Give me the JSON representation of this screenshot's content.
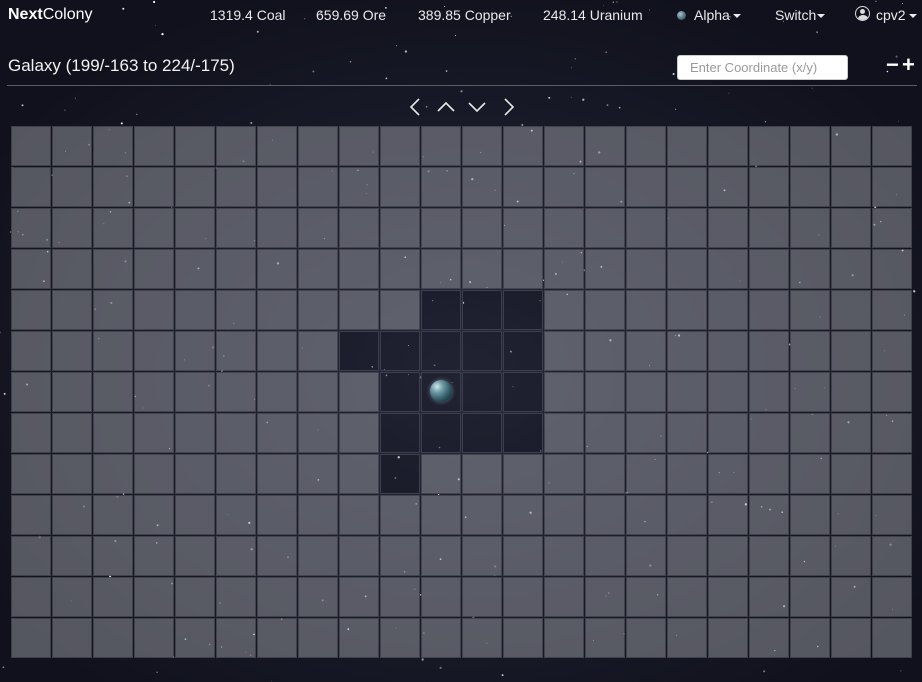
{
  "navbar": {
    "brand_bold": "Next",
    "brand_rest": "Colony",
    "resources": [
      {
        "id": "coal",
        "text": "1319.4 Coal"
      },
      {
        "id": "ore",
        "text": "659.69 Ore"
      },
      {
        "id": "copper",
        "text": "389.85 Copper"
      },
      {
        "id": "uranium",
        "text": "248.14 Uranium"
      }
    ],
    "planet_selector": "Alpha",
    "switch_label": "Switch",
    "user_label": "cpv2"
  },
  "galaxy": {
    "title": "Galaxy (199/-163 to 224/-175)",
    "coordinate_placeholder": "Enter Coordinate (x/y)",
    "zoom_out_label": "−",
    "zoom_in_label": "+",
    "grid": {
      "columns": 22,
      "rows": 13,
      "explored_cells": [
        [
          4,
          10
        ],
        [
          4,
          11
        ],
        [
          4,
          12
        ],
        [
          5,
          8
        ],
        [
          5,
          9
        ],
        [
          5,
          10
        ],
        [
          5,
          11
        ],
        [
          5,
          12
        ],
        [
          6,
          9
        ],
        [
          6,
          10
        ],
        [
          6,
          11
        ],
        [
          6,
          12
        ],
        [
          7,
          9
        ],
        [
          7,
          10
        ],
        [
          7,
          11
        ],
        [
          7,
          12
        ],
        [
          8,
          9
        ]
      ],
      "planet_cells": [
        [
          6,
          10
        ]
      ]
    }
  },
  "colors": {
    "background": "#12131f",
    "fog_cell": "#8c8e96",
    "explored_cell": "#181a26",
    "accent": "#ffffff"
  }
}
